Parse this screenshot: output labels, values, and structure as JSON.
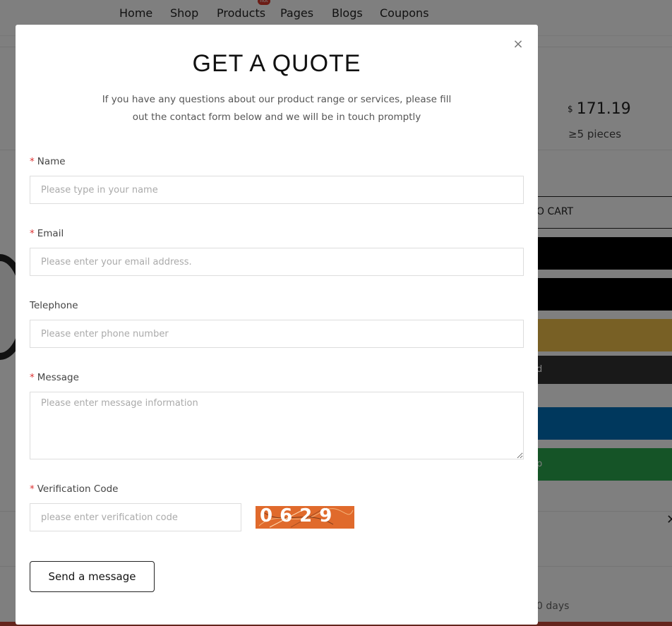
{
  "nav": {
    "items": [
      "Home",
      "Shop",
      "Products",
      "Pages",
      "Blogs",
      "Coupons"
    ],
    "hot_badge": "hot"
  },
  "product": {
    "currency": "$",
    "price": "171.19",
    "moq": "≥5 pieces",
    "add_to_cart_partial": "O CART",
    "button_partial_dark": "d",
    "button_partial_green": "p",
    "delivery_partial": "0 days"
  },
  "modal": {
    "close_glyph": "×",
    "title": "GET A QUOTE",
    "intro": "If you have any questions about our product range or services, please fill out the contact form below and we will be in touch promptly",
    "required_mark": "*",
    "fields": {
      "name": {
        "label": "Name",
        "placeholder": "Please type in your name"
      },
      "email": {
        "label": "Email",
        "placeholder": "Please enter your email address."
      },
      "telephone": {
        "label": "Telephone",
        "placeholder": "Please enter phone number"
      },
      "message": {
        "label": "Message",
        "placeholder": "Please enter message information"
      },
      "verification": {
        "label": "Verification Code",
        "placeholder": "please enter verification code",
        "captcha_text": "0629"
      }
    },
    "submit_label": "Send a message"
  },
  "colors": {
    "overlay": "rgba(0,0,0,0.5)",
    "required": "#dd3333",
    "captcha_bg": "#e06a2c",
    "pay_black": "#000000",
    "pay_gold": "#f0c14b",
    "pay_dark": "#333333",
    "pay_blue": "#0070ba",
    "pay_green": "#2aa84f"
  },
  "icons": {
    "close": "close-icon",
    "right_close": "close-icon"
  }
}
